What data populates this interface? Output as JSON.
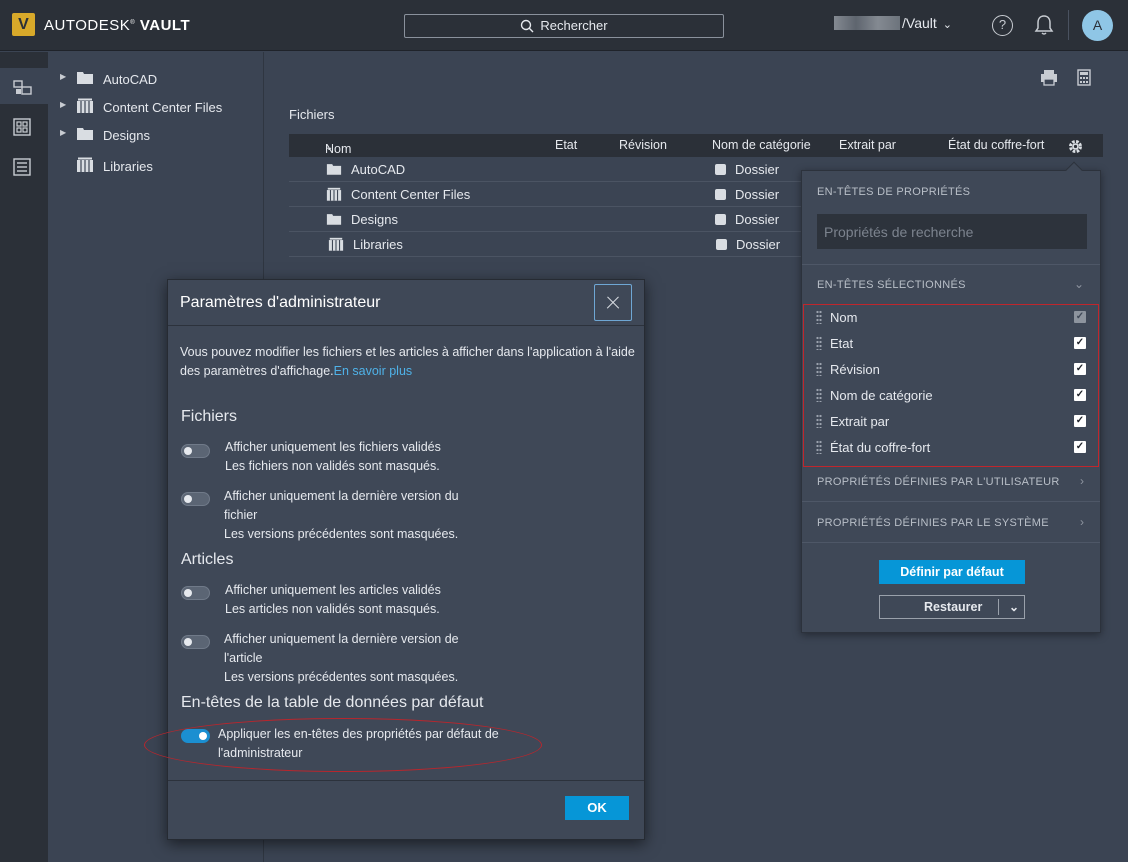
{
  "app": {
    "logo_letter": "V",
    "brand_light": "AUTODESK",
    "brand_bold": "VAULT"
  },
  "topbar": {
    "search_label": "Rechercher",
    "vault_name": "/Vault",
    "help_label": "?",
    "avatar_initial": "A"
  },
  "tree": {
    "items": [
      {
        "label": "AutoCAD",
        "icon": "folder-icon",
        "expandable": true
      },
      {
        "label": "Content Center Files",
        "icon": "library-folder-icon",
        "expandable": true
      },
      {
        "label": "Designs",
        "icon": "folder-icon",
        "expandable": true
      },
      {
        "label": "Libraries",
        "icon": "library-folder-icon",
        "expandable": false
      }
    ]
  },
  "main": {
    "title": "Fichiers",
    "columns": [
      "Nom",
      "Etat",
      "Révision",
      "Nom de catégorie",
      "Extrait par",
      "État du coffre-fort"
    ],
    "rows": [
      {
        "name": "AutoCAD",
        "category": "Dossier",
        "icon": "folder-icon"
      },
      {
        "name": "Content Center Files",
        "category": "Dossier",
        "icon": "library-folder-icon"
      },
      {
        "name": "Designs",
        "category": "Dossier",
        "icon": "folder-icon"
      },
      {
        "name": "Libraries",
        "category": "Dossier",
        "icon": "library-folder-icon"
      }
    ]
  },
  "column_panel": {
    "property_headers_title": "EN-TÊTES DE PROPRIÉTÉS",
    "search_placeholder": "Propriétés de recherche",
    "selected_headers_title": "EN-TÊTES SÉLECTIONNÉS",
    "selected": [
      {
        "label": "Nom",
        "checked": true,
        "disabled": true
      },
      {
        "label": "Etat",
        "checked": true,
        "disabled": false
      },
      {
        "label": "Révision",
        "checked": true,
        "disabled": false
      },
      {
        "label": "Nom de catégorie",
        "checked": true,
        "disabled": false
      },
      {
        "label": "Extrait par",
        "checked": true,
        "disabled": false
      },
      {
        "label": "État du coffre-fort",
        "checked": true,
        "disabled": false
      }
    ],
    "user_props_title": "PROPRIÉTÉS DÉFINIES PAR L'UTILISATEUR",
    "system_props_title": "PROPRIÉTÉS DÉFINIES PAR LE SYSTÈME",
    "set_default_label": "Définir par défaut",
    "restore_label": "Restaurer"
  },
  "dialog": {
    "title": "Paramètres d'administrateur",
    "intro": "Vous pouvez modifier les fichiers et les articles à afficher dans l'application à l'aide des paramètres d'affichage.",
    "learn_more": "En savoir plus",
    "files_heading": "Fichiers",
    "files_opt1_line1": "Afficher uniquement les fichiers validés",
    "files_opt1_line2": "Les fichiers non validés sont masqués.",
    "files_opt2_line1": "Afficher uniquement la dernière version du fichier",
    "files_opt2_line2": "Les versions précédentes sont masquées.",
    "items_heading": "Articles",
    "items_opt1_line1": "Afficher uniquement les articles validés",
    "items_opt1_line2": "Les articles non validés sont masqués.",
    "items_opt2_line1": "Afficher uniquement la dernière version de l'article",
    "items_opt2_line2": "Les versions précédentes sont masquées.",
    "table_heading": "En-têtes de la table de données par défaut",
    "table_opt_label": "Appliquer les en-têtes des propriétés par défaut de l'administrateur",
    "toggles": {
      "files_validated": false,
      "files_latest": false,
      "items_validated": false,
      "items_latest": false,
      "admin_headers": true
    },
    "ok_label": "OK"
  },
  "colors": {
    "accent": "#0696d7",
    "highlight": "#c0262c",
    "background": "#3b4453",
    "topbar": "#2b3038"
  }
}
